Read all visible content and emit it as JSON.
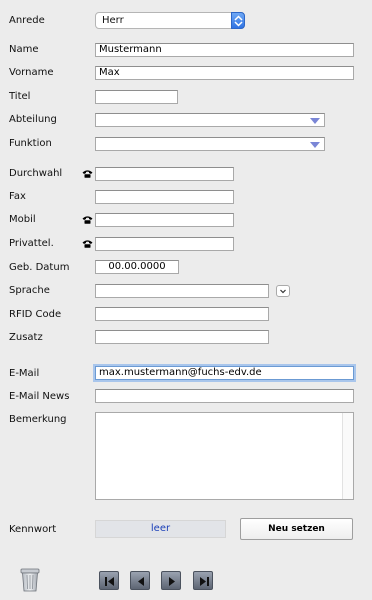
{
  "labels": {
    "anrede": "Anrede",
    "name": "Name",
    "vorname": "Vorname",
    "titel": "Titel",
    "abteilung": "Abteilung",
    "funktion": "Funktion",
    "durchwahl": "Durchwahl",
    "fax": "Fax",
    "mobil": "Mobil",
    "privattel": "Privattel.",
    "geb_datum": "Geb. Datum",
    "sprache": "Sprache",
    "rfid_code": "RFID Code",
    "zusatz": "Zusatz",
    "email": "E-Mail",
    "email_news": "E-Mail News",
    "bemerkung": "Bemerkung",
    "kennwort": "Kennwort"
  },
  "values": {
    "anrede": "Herr",
    "name": "Mustermann",
    "vorname": "Max",
    "titel": "",
    "abteilung": "",
    "funktion": "",
    "durchwahl": "",
    "fax": "",
    "mobil": "",
    "privattel": "",
    "geb_datum": "00.00.0000",
    "sprache": "",
    "rfid_code": "",
    "zusatz": "",
    "email": "max.mustermann@fuchs-edv.de",
    "email_news": "",
    "bemerkung": "",
    "kennwort_status": "leer"
  },
  "buttons": {
    "neu_setzen": "Neu setzen"
  },
  "icons": {
    "phone": "phone-icon",
    "trash": "trash-icon",
    "nav_first": "first-record-icon",
    "nav_prev": "previous-record-icon",
    "nav_next": "next-record-icon",
    "nav_last": "last-record-icon"
  },
  "colors": {
    "background": "#ececec",
    "focus": "#6b9ad3",
    "stepper": "#2f73e3",
    "kennwort_status": "#1b3fb8"
  }
}
